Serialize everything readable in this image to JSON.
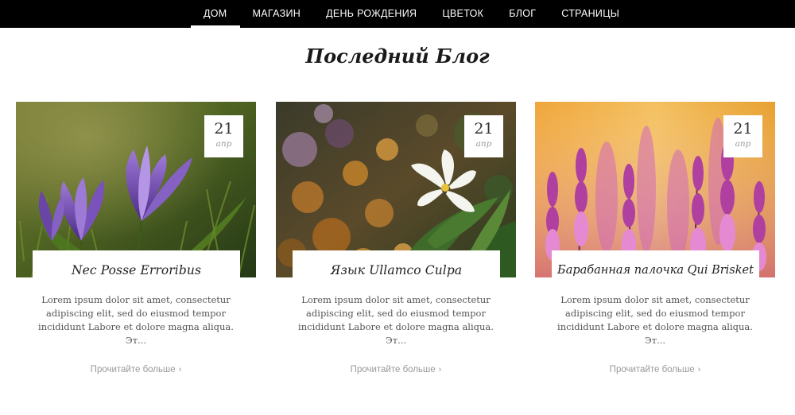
{
  "nav": {
    "items": [
      {
        "label": "ДОМ",
        "active": true
      },
      {
        "label": "МАГАЗИН"
      },
      {
        "label": "ДЕНЬ РОЖДЕНИЯ"
      },
      {
        "label": "ЦВЕТОК"
      },
      {
        "label": "БЛОГ"
      },
      {
        "label": "СТРАНИЦЫ"
      }
    ]
  },
  "section": {
    "title": "Последний Блог"
  },
  "posts": [
    {
      "day": "21",
      "month": "апр",
      "title": "Nec Posse Erroribus",
      "excerpt": "Lorem ipsum dolor sit amet, consectetur adipiscing elit, sed do eiusmod tempor incididunt Labore et dolore magna aliqua. Эт...",
      "read_more": "Прочитайте больше",
      "image": "purple-crocus-flowers"
    },
    {
      "day": "21",
      "month": "апр",
      "title": "Язык Ullamco Culpa",
      "excerpt": "Lorem ipsum dolor sit amet, consectetur adipiscing elit, sed do eiusmod tempor incididunt Labore et dolore magna aliqua. Эт...",
      "read_more": "Прочитайте больше",
      "image": "white-flower-bokeh"
    },
    {
      "day": "21",
      "month": "апр",
      "title": "Барабанная палочка Qui Brisket",
      "excerpt": "Lorem ipsum dolor sit amet, consectetur adipiscing elit, sed do eiusmod tempor incididunt Labore et dolore magna aliqua. Эт...",
      "read_more": "Прочитайте больше",
      "image": "lavender-sage-flowers"
    }
  ],
  "icons": {
    "read_more": "chevron-right-icon"
  },
  "colors": {
    "nav_bg": "#000000",
    "text_muted": "#999999",
    "title": "#222222"
  }
}
